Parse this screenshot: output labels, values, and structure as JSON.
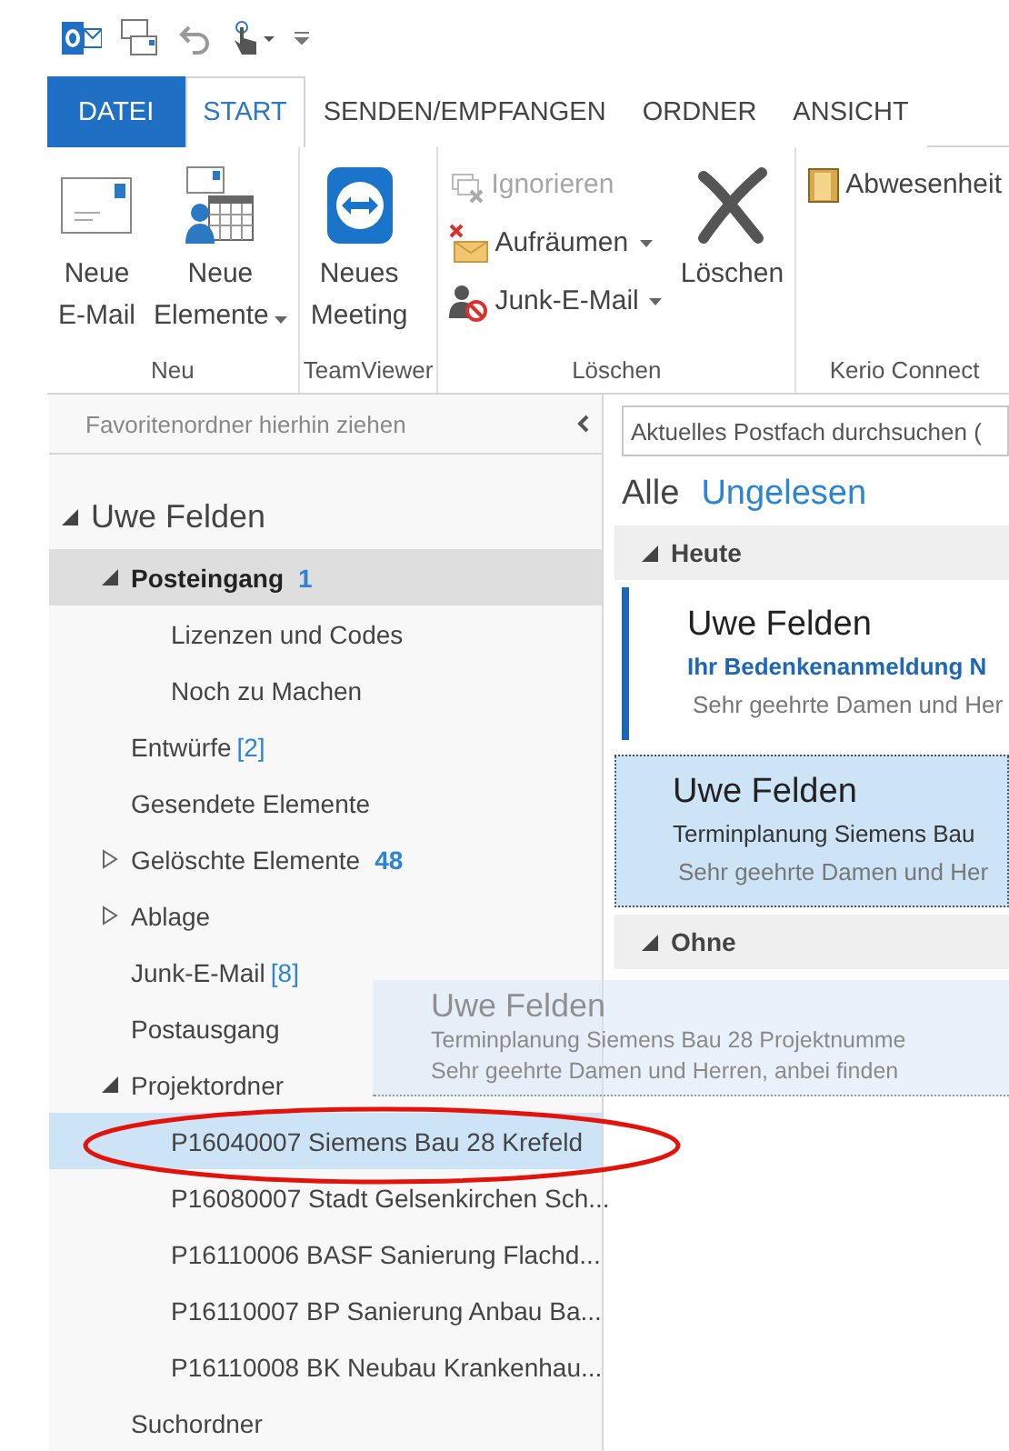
{
  "ribbon_tabs": [
    {
      "label": "DATEI",
      "kind": "file",
      "selected": false
    },
    {
      "label": "START",
      "kind": "tab",
      "selected": true
    },
    {
      "label": "SENDEN/EMPFANGEN",
      "kind": "tab",
      "selected": false
    },
    {
      "label": "ORDNER",
      "kind": "tab",
      "selected": false
    },
    {
      "label": "ANSICHT",
      "kind": "tab",
      "selected": false
    }
  ],
  "ribbon_groups": [
    {
      "name": "Neu",
      "buttons": [
        {
          "kind": "large",
          "lines": [
            "Neue",
            "E-Mail"
          ],
          "dropdown": false
        },
        {
          "kind": "large",
          "lines": [
            "Neue",
            "Elemente"
          ],
          "dropdown": true
        }
      ]
    },
    {
      "name": "TeamViewer",
      "buttons": [
        {
          "kind": "large",
          "lines": [
            "Neues",
            "Meeting"
          ],
          "dropdown": false
        }
      ]
    },
    {
      "name": "Löschen",
      "buttons": [
        {
          "kind": "small",
          "lines": [
            "Ignorieren"
          ],
          "dropdown": false,
          "disabled": true
        },
        {
          "kind": "small",
          "lines": [
            "Aufräumen"
          ],
          "dropdown": true,
          "disabled": false
        },
        {
          "kind": "small",
          "lines": [
            "Junk-E-Mail"
          ],
          "dropdown": true,
          "disabled": false
        },
        {
          "kind": "large",
          "lines": [
            "Löschen"
          ],
          "dropdown": false
        }
      ]
    },
    {
      "name": "Kerio Connect",
      "buttons": [
        {
          "kind": "small",
          "lines": [
            "Abwesenheit"
          ],
          "dropdown": false,
          "disabled": false
        }
      ]
    }
  ],
  "favorites_hint": "Favoritenordner hierhin ziehen",
  "folders": [
    {
      "label": "Uwe Felden",
      "kind": "account",
      "expanded": true,
      "selected": false,
      "drop_target": false,
      "children": [
        {
          "label": "Posteingang",
          "count": "1",
          "count_bold": true,
          "expanded": true,
          "selected": true,
          "drop_target": false,
          "children": [
            {
              "label": "Lizenzen und Codes",
              "selected": false,
              "drop_target": false
            },
            {
              "label": "Noch zu Machen",
              "selected": false,
              "drop_target": false
            }
          ]
        },
        {
          "label": "Entwürfe",
          "count": "[2]",
          "count_bold": false,
          "selected": false,
          "drop_target": false
        },
        {
          "label": "Gesendete Elemente",
          "selected": false,
          "drop_target": false
        },
        {
          "label": "Gelöschte Elemente",
          "count": "48",
          "count_bold": true,
          "expanded": false,
          "selected": false,
          "drop_target": false
        },
        {
          "label": "Ablage",
          "expanded": false,
          "selected": false,
          "drop_target": false
        },
        {
          "label": "Junk-E-Mail",
          "count": "[8]",
          "count_bold": false,
          "selected": false,
          "drop_target": false
        },
        {
          "label": "Postausgang",
          "selected": false,
          "drop_target": false
        },
        {
          "label": "Projektordner",
          "expanded": true,
          "selected": false,
          "drop_target": false,
          "children": [
            {
              "label": "P16040007 Siemens Bau 28 Krefeld",
              "selected": false,
              "drop_target": true
            },
            {
              "label": "P16080007 Stadt Gelsenkirchen Sch...",
              "selected": false,
              "drop_target": false
            },
            {
              "label": "P16110006 BASF Sanierung Flachd...",
              "selected": false,
              "drop_target": false
            },
            {
              "label": "P16110007 BP Sanierung Anbau Ba...",
              "selected": false,
              "drop_target": false
            },
            {
              "label": "P16110008 BK Neubau Krankenhau...",
              "selected": false,
              "drop_target": false
            }
          ]
        },
        {
          "label": "Suchordner",
          "selected": false,
          "drop_target": false
        }
      ]
    }
  ],
  "search": {
    "placeholder": "Aktuelles Postfach durchsuchen ("
  },
  "filters": [
    {
      "label": "Alle",
      "selected": true
    },
    {
      "label": "Ungelesen",
      "selected": false
    }
  ],
  "message_groups": [
    {
      "label": "Heute",
      "expanded": true,
      "messages": [
        {
          "sender": "Uwe Felden",
          "subject": "Ihr Bedenkenanmeldung N",
          "preview": "Sehr geehrte Damen und Her",
          "unread": true,
          "selected": false
        },
        {
          "sender": "Uwe Felden",
          "subject": "Terminplanung Siemens Bau",
          "preview": "Sehr geehrte Damen und Her",
          "unread": false,
          "selected": true
        }
      ]
    },
    {
      "label": "Ohne",
      "expanded": true
    }
  ],
  "drag_preview": {
    "sender": "Uwe Felden",
    "subject": "Terminplanung Siemens Bau 28 Projektnumme",
    "preview": "Sehr geehrte Damen und Herren,  anbei finden"
  }
}
